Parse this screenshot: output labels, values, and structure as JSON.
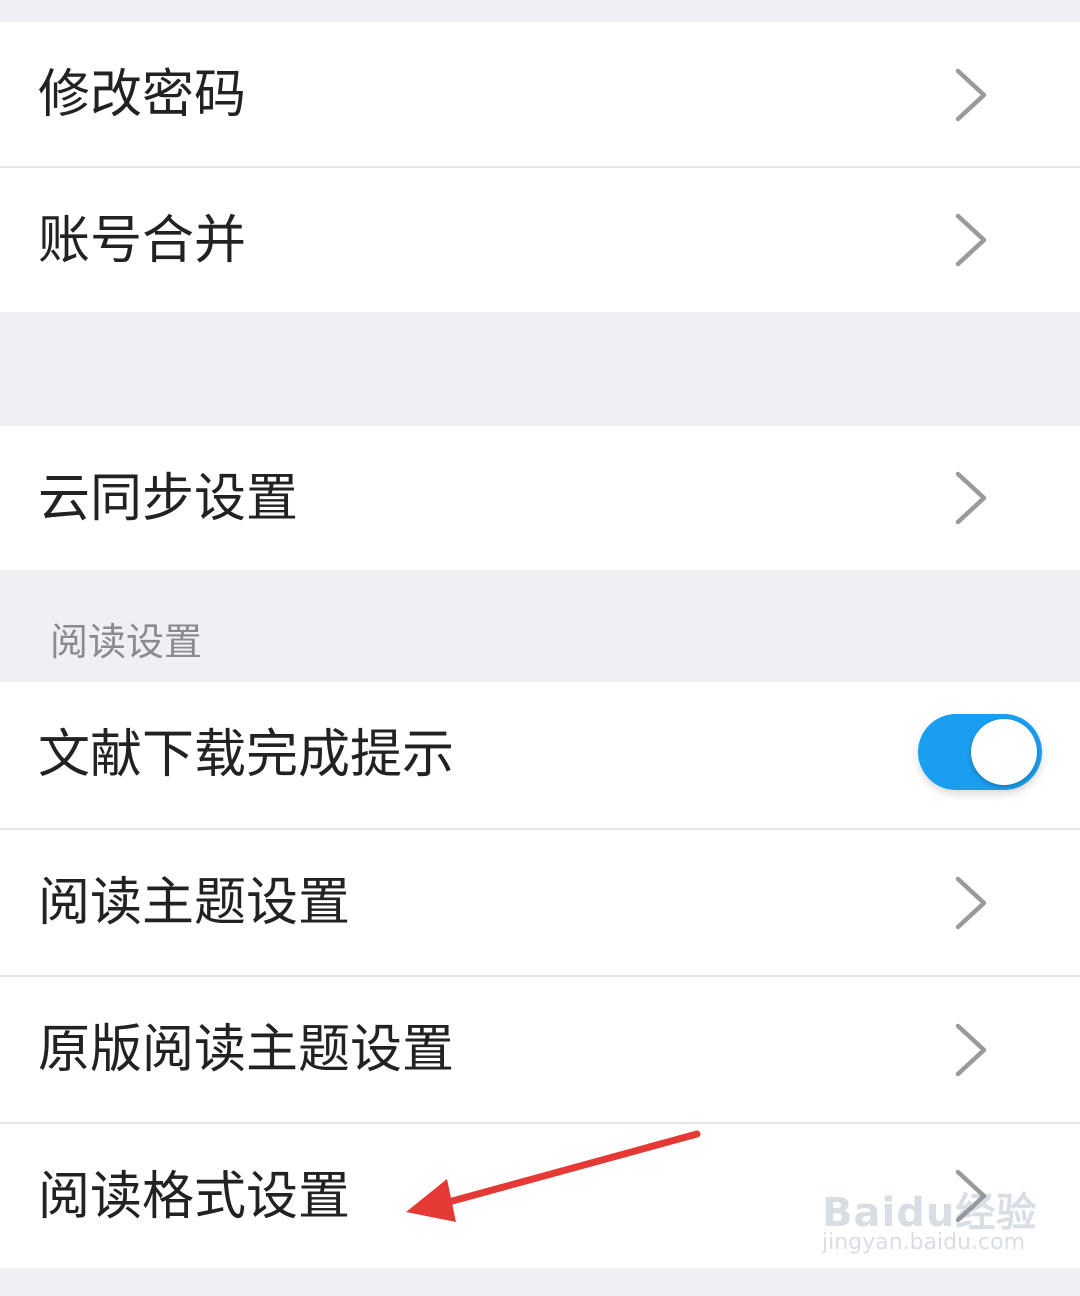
{
  "settings": {
    "rows": {
      "change_password": "修改密码",
      "account_merge": "账号合并",
      "cloud_sync": "云同步设置",
      "download_notice": "文献下载完成提示",
      "reading_theme": "阅读主题设置",
      "original_reading_theme": "原版阅读主题设置",
      "reading_format": "阅读格式设置"
    },
    "section_reading_header": "阅读设置",
    "download_notice_toggle": "on"
  },
  "icons": {
    "chevron": "chevron-right-icon",
    "annotation_arrow": "red-arrow-icon"
  },
  "colors": {
    "toggle_on": "#1a9ef0",
    "annotation_arrow": "#e53935",
    "background": "#efeff4"
  },
  "watermark": {
    "brand": "Baidu经验",
    "url": "jingyan.baidu.com"
  }
}
